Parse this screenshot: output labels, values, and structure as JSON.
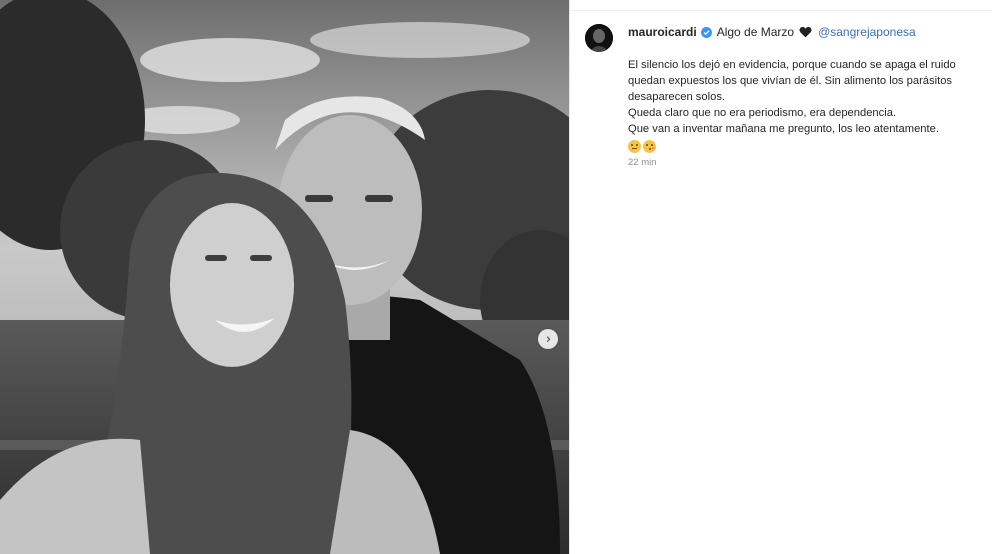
{
  "post": {
    "image_alt": "Foto en blanco y negro de una pareja sonriendo al aire libre",
    "next_icon": "chevron-right-icon",
    "author": {
      "username": "mauroicardi",
      "verified_icon": "verified-badge-icon"
    },
    "caption_title": "Algo de Marzo",
    "heart_icon": "black-heart-icon",
    "mention": "@sangrejaponesa",
    "caption_lines": [
      "El silencio los dejó en evidencia, porque cuando se apaga el ruido quedan expuestos los que vivían de él. Sin alimento los parásitos desaparecen solos.",
      "Queda claro que no era periodismo, era dependencia.",
      "Que van a inventar mañana me pregunto, los leo atentamente."
    ],
    "emoji_icons": [
      "smiling-face-icon",
      "kissing-face-icon"
    ],
    "timestamp": "22 min",
    "colors": {
      "mention": "#3b6fb5",
      "verified": "#3897f0",
      "timestamp": "#8e8e8e"
    }
  }
}
